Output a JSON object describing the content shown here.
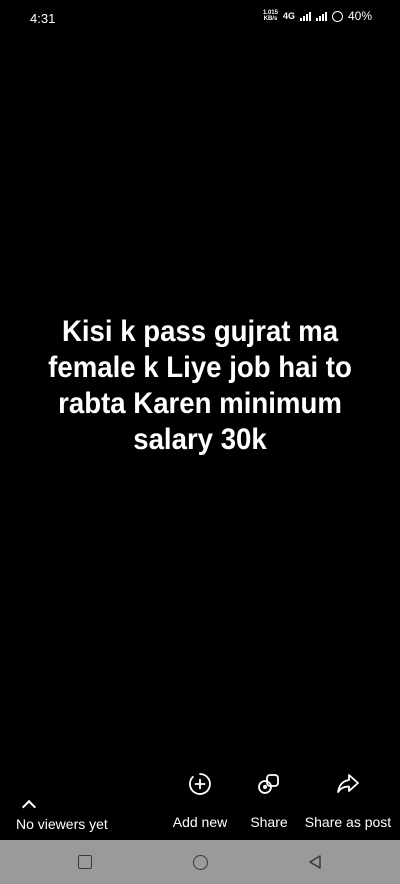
{
  "status_bar": {
    "time": "4:31",
    "net_speed_value": "1.015",
    "net_speed_unit": "KB/s",
    "network_type": "4G",
    "battery": "40%"
  },
  "story": {
    "text": "Kisi k pass gujrat ma female k Liye job hai to rabta Karen minimum salary 30k",
    "background_color": "#000000"
  },
  "bottom_bar": {
    "viewers_label": "No viewers yet",
    "actions": [
      {
        "label": "Add new",
        "icon": "add-circle-icon"
      },
      {
        "label": "Share",
        "icon": "share-apps-icon"
      },
      {
        "label": "Share as post",
        "icon": "forward-arrow-icon"
      }
    ]
  },
  "nav_bar": {
    "buttons": [
      "recents-square-icon",
      "home-circle-icon",
      "back-triangle-icon"
    ],
    "background_color": "#9a9a9a"
  }
}
